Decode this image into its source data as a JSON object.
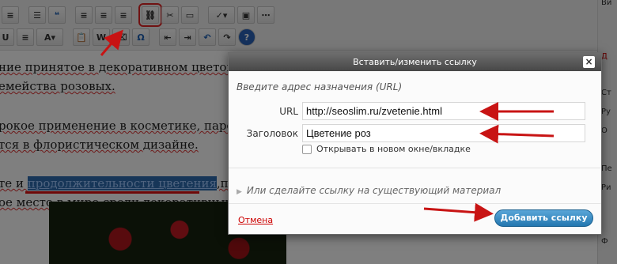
{
  "dialog": {
    "title": "Вставить/изменить ссылку",
    "close_glyph": "×",
    "hint": "Введите адрес назначения (URL)",
    "url_label": "URL",
    "url_value": "http://seoslim.ru/zvetenie.html",
    "title_label": "Заголовок",
    "title_value": "Цветение роз",
    "new_window_label": "Открывать в новом окне/вкладке",
    "new_window_checked": false,
    "existing_content_label": "Или сделайте ссылку на существующий материал",
    "cancel_label": "Отмена",
    "submit_label": "Добавить ссылку"
  },
  "editor": {
    "lines": [
      "ние принятое в декоративном цветовод",
      "емейства розовых.",
      "рокое применение в косметике, парфюм",
      "тся в флористическом дизайне.",
      "те и ",
      "продолжительности цветения",
      ",приз",
      "ое место в мире среди декоративных ра"
    ]
  },
  "right_strip": {
    "top_text": "Ви",
    "marks": [
      "Д",
      "Ст",
      "Ру",
      "О",
      "Пе",
      "Ри",
      "Ф"
    ]
  },
  "colors": {
    "accent_red": "#e02525",
    "submit_blue": "#2377b0",
    "selection": "#2f6db0"
  }
}
